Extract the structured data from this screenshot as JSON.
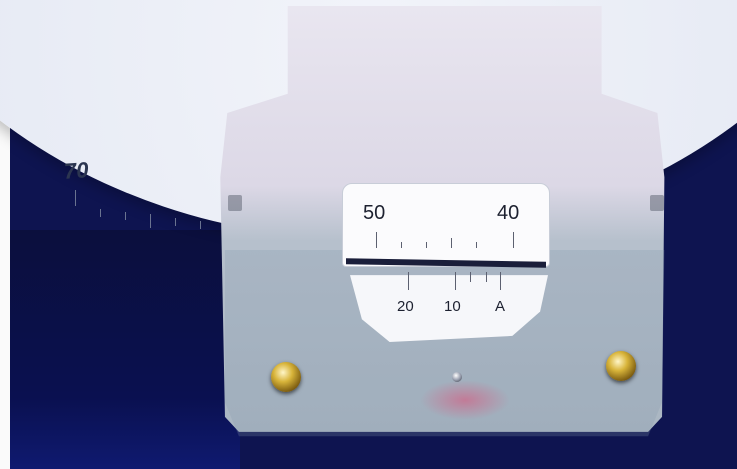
{
  "dial": {
    "numeral": "70"
  },
  "window": {
    "upper_scale": {
      "left": "50",
      "right": "40"
    },
    "lower_scale": {
      "first": "20",
      "second": "10",
      "third": "A"
    }
  },
  "colors": {
    "background": "#0e1450",
    "disc": "#e6eaf4",
    "plate": "#dcd8e6",
    "screw": "#d8b43a"
  }
}
